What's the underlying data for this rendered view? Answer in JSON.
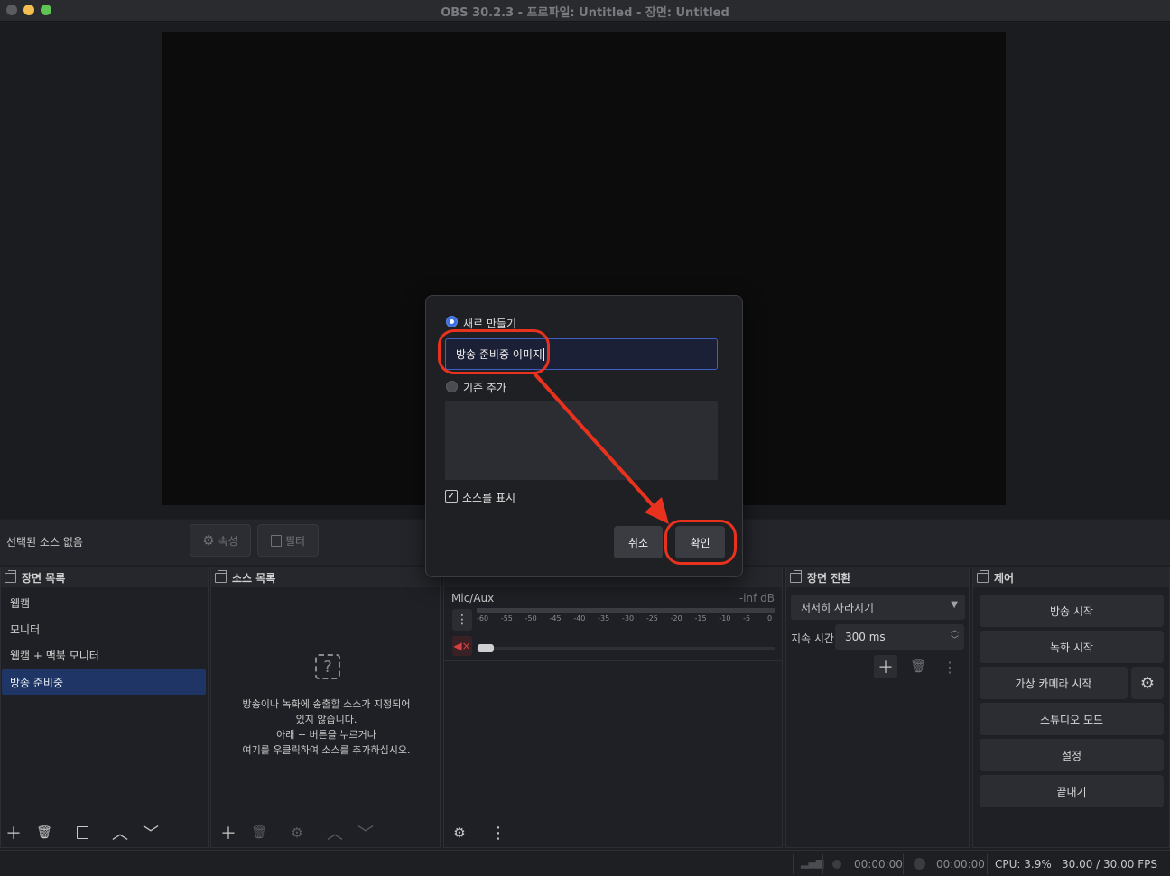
{
  "window": {
    "title": "OBS 30.2.3 - 프로파일: Untitled - 장면: Untitled",
    "traffic_lights": [
      "#ed6a5e",
      "#f5bf4f",
      "#61c554"
    ]
  },
  "context_bar": {
    "no_source": "선택된 소스 없음",
    "properties_label": "속성",
    "filters_label": "필터"
  },
  "scenes_dock": {
    "title": "장면 목록",
    "items": [
      {
        "label": "웹캠",
        "active": false
      },
      {
        "label": "모니터",
        "active": false
      },
      {
        "label": "웹캠 + 맥북 모니터",
        "active": false
      },
      {
        "label": "방송 준비중",
        "active": true
      }
    ]
  },
  "sources_dock": {
    "title": "소스 목록",
    "empty_lines": [
      "방송이나 녹화에 송출할 소스가 지정되어",
      "있지 않습니다.",
      "아래 + 버튼을 누르거나",
      "여기를 우클릭하여 소스를 추가하십시오."
    ]
  },
  "mixer_dock": {
    "channel": "Mic/Aux",
    "level": "-inf dB",
    "ticks": [
      "-60",
      "-55",
      "-50",
      "-45",
      "-40",
      "-35",
      "-30",
      "-25",
      "-20",
      "-15",
      "-10",
      "-5",
      "0"
    ]
  },
  "transitions_dock": {
    "title": "장면 전환",
    "transition": "서서히 사라지기",
    "duration_label": "지속 시간",
    "duration_value": "300 ms"
  },
  "controls_dock": {
    "title": "제어",
    "buttons": [
      "방송 시작",
      "녹화 시작",
      "가상 카메라 시작",
      "스튜디오 모드",
      "설정",
      "끝내기"
    ]
  },
  "status_bar": {
    "stream_time": "00:00:00",
    "record_time": "00:00:00",
    "cpu": "CPU: 3.9%",
    "fps": "30.00 / 30.00 FPS"
  },
  "dialog": {
    "create_new_label": "새로 만들기",
    "name_value": "방송 준비중 이미지",
    "add_existing_label": "기존 추가",
    "visible_label": "소스를 표시",
    "visible_checked": true,
    "cancel_label": "취소",
    "ok_label": "확인"
  },
  "colors": {
    "accent": "#3e5fc4",
    "annotation": "#e8321e",
    "selected_scene": "#1e3565"
  }
}
